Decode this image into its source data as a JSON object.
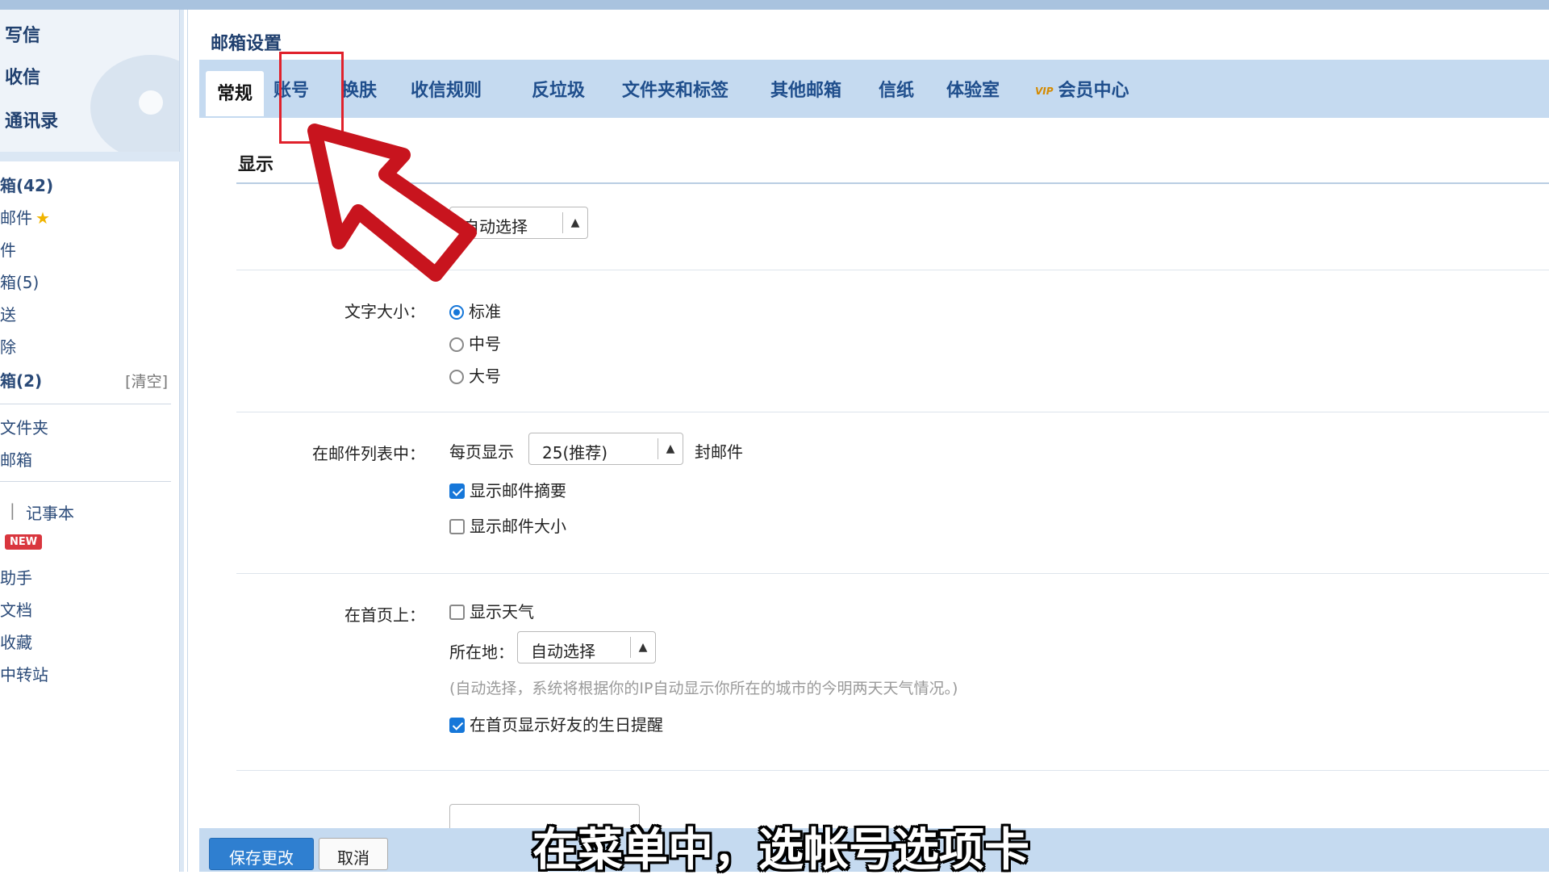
{
  "sidebar": {
    "quick_actions": [
      "写信",
      "收信",
      "通讯录"
    ],
    "folders": [
      {
        "label": "箱(42)",
        "bold": true
      },
      {
        "label": "邮件",
        "star": true
      },
      {
        "label": "件"
      },
      {
        "label": "箱(5)"
      },
      {
        "label": "送"
      },
      {
        "label": "除"
      },
      {
        "label": "箱(2)",
        "bold": true
      }
    ],
    "clear_label": "[清空]",
    "groups": [
      "文件夹",
      "邮箱"
    ],
    "tools": [
      "记事本"
    ],
    "new_badge": "NEW",
    "extras": [
      "助手",
      "文档",
      "收藏",
      "中转站"
    ]
  },
  "main": {
    "title": "邮箱设置",
    "tabs": [
      "常规",
      "账号",
      "换肤",
      "收信规则",
      "反垃圾",
      "文件夹和标签",
      "其他邮箱",
      "信纸",
      "体验室",
      "会员中心"
    ],
    "vip_badge": "VIP",
    "active_tab": "常规",
    "section_title": "显示",
    "language_select": "自动选择",
    "font_size": {
      "label": "文字大小：",
      "options": [
        "标准",
        "中号",
        "大号"
      ],
      "selected": "标准"
    },
    "mail_list": {
      "label": "在邮件列表中：",
      "per_page_prefix": "每页显示",
      "per_page_value": "25(推荐)",
      "per_page_suffix": "封邮件",
      "show_summary": "显示邮件摘要",
      "show_summary_checked": true,
      "show_size": "显示邮件大小",
      "show_size_checked": false
    },
    "homepage": {
      "label": "在首页上：",
      "show_weather": "显示天气",
      "show_weather_checked": false,
      "location_label": "所在地：",
      "location_value": "自动选择",
      "hint": "(自动选择，系统将根据你的IP自动显示你所在的城市的今明两天天气情况。)",
      "birthday": "在首页显示好友的生日提醒",
      "birthday_checked": true
    },
    "save_button": "保存更改",
    "cancel_button": "取消"
  },
  "overlay": {
    "subtitle": "在菜单中，选帐号选项卡",
    "highlight_color": "#e0212b"
  }
}
